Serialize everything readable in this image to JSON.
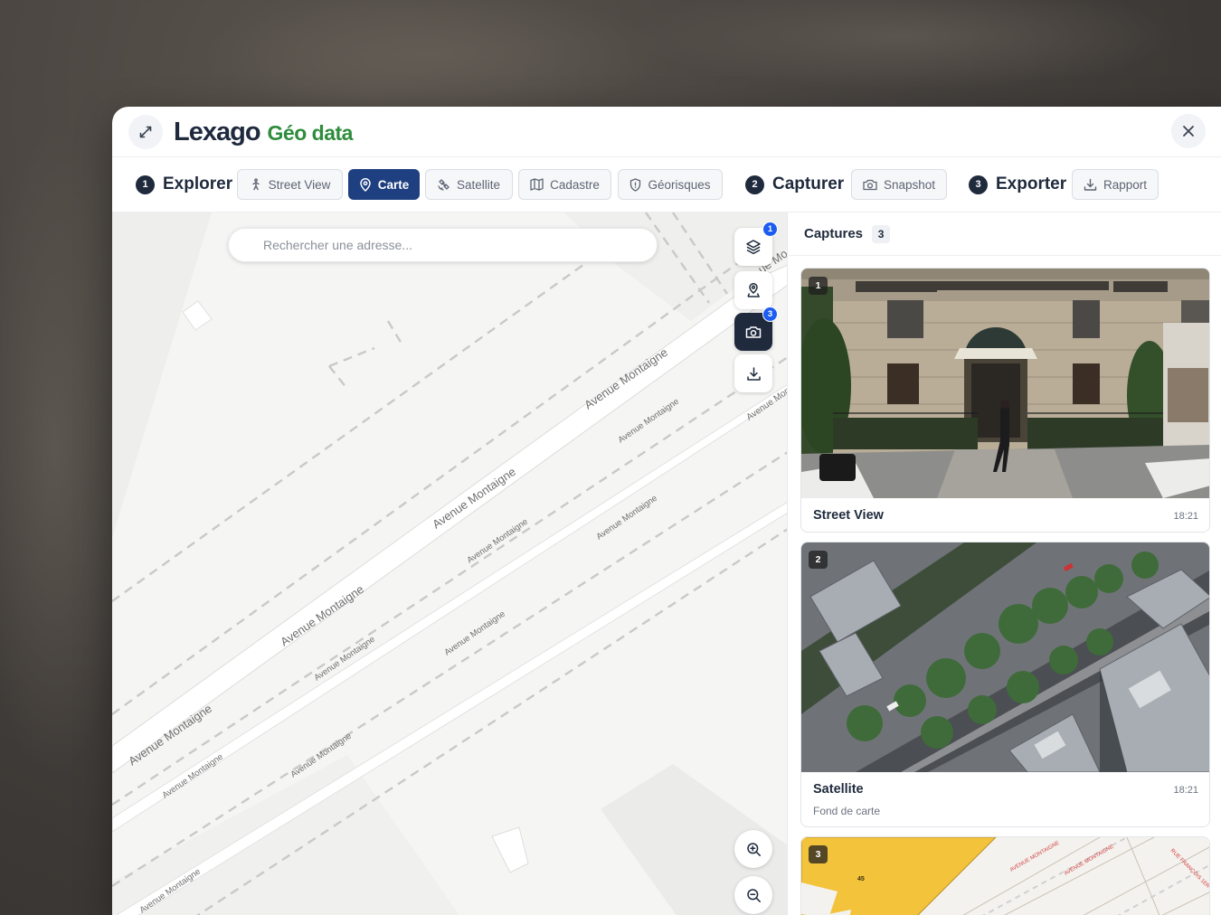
{
  "app": {
    "brand": "Lexago",
    "product": "Géo data"
  },
  "toolbar": {
    "steps": [
      {
        "num": "1",
        "label": "Explorer"
      },
      {
        "num": "2",
        "label": "Capturer"
      },
      {
        "num": "3",
        "label": "Exporter"
      }
    ],
    "explorer_buttons": {
      "street_view": "Street View",
      "carte": "Carte",
      "satellite": "Satellite",
      "cadastre": "Cadastre",
      "georisques": "Géorisques"
    },
    "snapshot": "Snapshot",
    "rapport": "Rapport",
    "active": "Carte"
  },
  "map": {
    "search_placeholder": "Rechercher une adresse...",
    "street_name": "Avenue Montaigne",
    "street_fragment": "ue Mo",
    "street_fragment_2": "Avenue Mont",
    "layers_badge": "1",
    "camera_badge": "3"
  },
  "captures": {
    "title": "Captures",
    "count": "3",
    "items": [
      {
        "num": "1",
        "title": "Street View",
        "time": "18:21",
        "subtitle": ""
      },
      {
        "num": "2",
        "title": "Satellite",
        "time": "18:21",
        "subtitle": "Fond de carte"
      },
      {
        "num": "3",
        "title": "",
        "time": "",
        "subtitle": ""
      }
    ],
    "cadastre_labels": {
      "parcel_45": "45",
      "street_a": "AVENUE MONTAIGNE",
      "street_b": "AVENUE MONTAIGNE",
      "street_c": "RUE FRANÇOIS 1ER"
    }
  },
  "colors": {
    "brand_navy": "#1f2a3d",
    "brand_green": "#2f8c3d",
    "active_button": "#1e3f80",
    "badge_blue": "#1d5cf0",
    "cadastre_yellow": "#f3c33c"
  }
}
